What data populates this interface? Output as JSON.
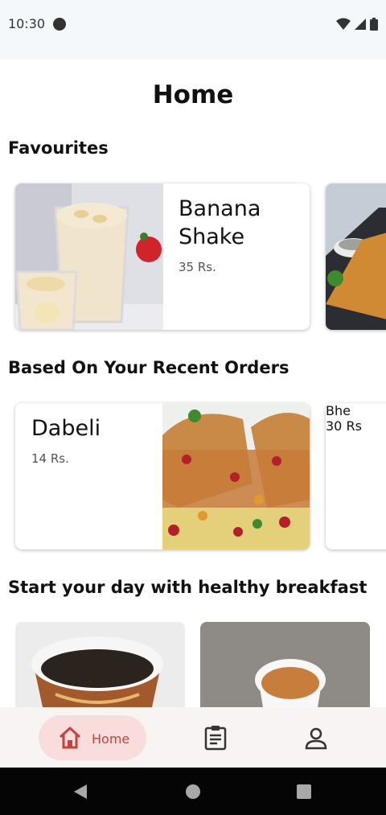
{
  "status_bar": {
    "time": "10:30"
  },
  "page": {
    "title": "Home"
  },
  "favourites": {
    "title": "Favourites",
    "items": [
      {
        "name": "Banana Shake",
        "price": "35 Rs."
      }
    ]
  },
  "recent": {
    "title": "Based On Your Recent Orders",
    "items": [
      {
        "name": "Dabeli",
        "price": "14 Rs."
      },
      {
        "name": "Bhe",
        "price": "30 Rs"
      }
    ]
  },
  "breakfast": {
    "title": "Start your day with healthy breakfast"
  },
  "bottom_nav": {
    "items": [
      {
        "label": "Home",
        "icon": "home-icon",
        "active": true
      },
      {
        "label": "",
        "icon": "clipboard-icon"
      },
      {
        "label": "",
        "icon": "person-icon"
      }
    ]
  },
  "colors": {
    "accent": "#c3443f",
    "accent_bg": "#f9dddc"
  }
}
